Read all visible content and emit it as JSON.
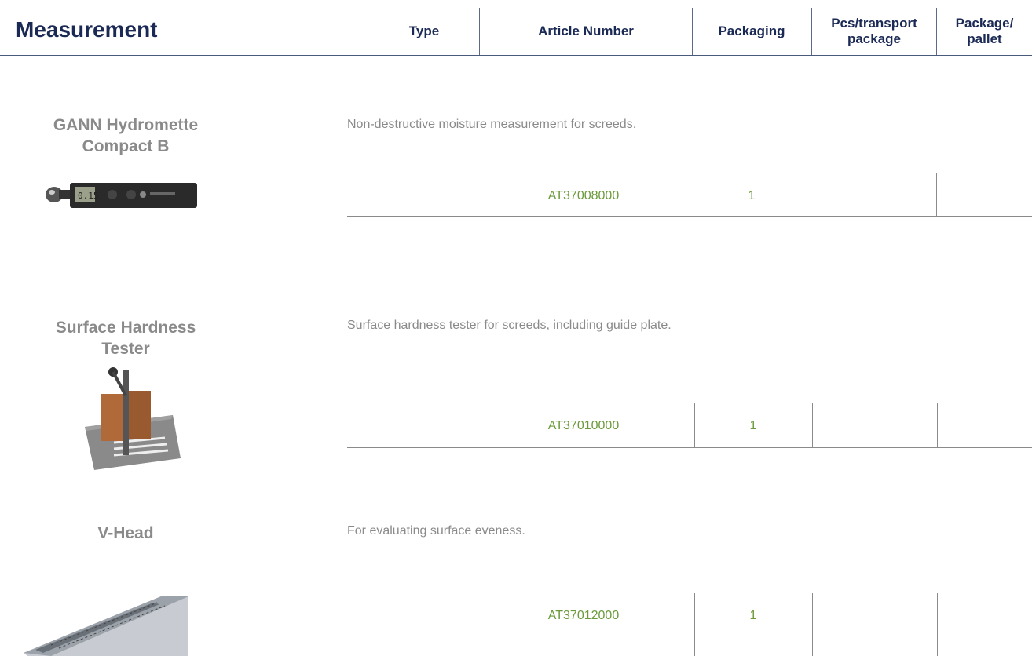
{
  "header": {
    "title": "Measurement",
    "columns": [
      "Type",
      "Article Number",
      "Packaging",
      "Pcs/transport\npackage",
      "Package/\npallet"
    ]
  },
  "products": [
    {
      "name": "GANN Hydromette\nCompact B",
      "description": "Non-destructive moisture measurement for screeds.",
      "article_number": "AT37008000",
      "packaging": "1",
      "pcs_transport": "",
      "package_pallet": ""
    },
    {
      "name": "Surface Hardness\nTester",
      "description": "Surface hardness tester for screeds, including guide plate.",
      "article_number": "AT37010000",
      "packaging": "1",
      "pcs_transport": "",
      "package_pallet": ""
    },
    {
      "name": "V-Head",
      "description": "For evaluating surface eveness.",
      "article_number": "AT37012000",
      "packaging": "1",
      "pcs_transport": "",
      "package_pallet": ""
    }
  ]
}
